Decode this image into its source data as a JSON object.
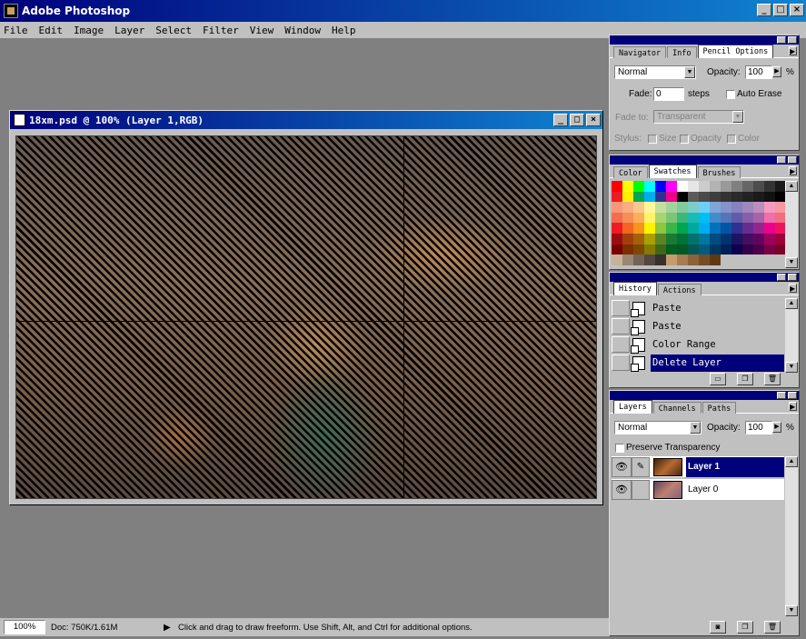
{
  "app": {
    "title": "Adobe Photoshop"
  },
  "window_buttons": {
    "minimize": "_",
    "maximize": "□",
    "close": "×"
  },
  "menu": [
    "File",
    "Edit",
    "Image",
    "Layer",
    "Select",
    "Filter",
    "View",
    "Window",
    "Help"
  ],
  "document": {
    "title": "18xm.psd @ 100% (Layer 1,RGB)"
  },
  "navigator_panel": {
    "tabs": [
      "Navigator",
      "Info",
      "Pencil Options"
    ],
    "active_tab": "Pencil Options",
    "mode": "Normal",
    "opacity_label": "Opacity:",
    "opacity_value": "100",
    "percent": "%",
    "fade_label": "Fade:",
    "fade_value": "0",
    "fade_unit": "steps",
    "auto_erase": "Auto Erase",
    "fade_to_label": "Fade to:",
    "fade_to_value": "Transparent",
    "stylus_label": "Stylus:",
    "stylus_size": "Size",
    "stylus_opacity": "Opacity",
    "stylus_color": "Color"
  },
  "color_panel": {
    "tabs": [
      "Color",
      "Swatches",
      "Brushes"
    ],
    "active_tab": "Swatches",
    "swatches": [
      "#ff0000",
      "#ffff00",
      "#00ff00",
      "#00ffff",
      "#0000ff",
      "#ff00ff",
      "#ffffff",
      "#e6e6e6",
      "#cccccc",
      "#b3b3b3",
      "#999999",
      "#808080",
      "#666666",
      "#4d4d4d",
      "#333333",
      "#1a1a1a",
      "#ed1c24",
      "#fff200",
      "#00a651",
      "#00aeef",
      "#2e3192",
      "#ec008c",
      "#000000",
      "#5a5a5a",
      "#4a4a4a",
      "#3e3e3e",
      "#333333",
      "#2a2a2a",
      "#222222",
      "#1a1a1a",
      "#111111",
      "#000000",
      "#f7977a",
      "#f9ad81",
      "#fdc68a",
      "#fff79a",
      "#c4df9b",
      "#a3d39c",
      "#82ca9d",
      "#7bcdc8",
      "#6ecff6",
      "#7ea7d8",
      "#8493ca",
      "#8882be",
      "#a187be",
      "#bc8dbf",
      "#f49ac2",
      "#f6989d",
      "#f26c4f",
      "#f68e55",
      "#fbaf5c",
      "#fff467",
      "#acd372",
      "#7cc576",
      "#3bb878",
      "#1abbb4",
      "#00bff3",
      "#438ccb",
      "#5574b9",
      "#605ca8",
      "#855fa8",
      "#a763a8",
      "#f06ea9",
      "#f26d7d",
      "#ed1c24",
      "#f26522",
      "#f7941d",
      "#fff200",
      "#8dc63f",
      "#39b54a",
      "#00a651",
      "#00a99d",
      "#00aeef",
      "#0072bc",
      "#0054a6",
      "#2e3192",
      "#662d91",
      "#92278f",
      "#ec008c",
      "#ed145b",
      "#9e0b0f",
      "#a0410d",
      "#a3620a",
      "#aba000",
      "#598527",
      "#1a7b30",
      "#007236",
      "#00746b",
      "#0076a3",
      "#004b80",
      "#003471",
      "#1b1464",
      "#440e62",
      "#630460",
      "#9e005d",
      "#9e0039",
      "#790000",
      "#7b2e00",
      "#7d4900",
      "#827b00",
      "#406618",
      "#005e20",
      "#005826",
      "#005952",
      "#005b7f",
      "#003663",
      "#002157",
      "#0d004c",
      "#32004b",
      "#4b0049",
      "#7b0046",
      "#7a0026",
      "#c7b299",
      "#998675",
      "#736357",
      "#534741",
      "#37302d",
      "#c69c6d",
      "#a67c52",
      "#8c6239",
      "#754c24",
      "#603913",
      "#c0c0c0",
      "#c0c0c0",
      "#c0c0c0",
      "#c0c0c0",
      "#c0c0c0",
      "#c0c0c0"
    ]
  },
  "history_panel": {
    "tabs": [
      "History",
      "Actions"
    ],
    "active_tab": "History",
    "items": [
      "Paste",
      "Paste",
      "Color Range",
      "Delete Layer"
    ],
    "selected_index": 3
  },
  "layers_panel": {
    "tabs": [
      "Layers",
      "Channels",
      "Paths"
    ],
    "active_tab": "Layers",
    "mode": "Normal",
    "opacity_label": "Opacity:",
    "opacity_value": "100",
    "percent": "%",
    "preserve_transparency": "Preserve Transparency",
    "layers": [
      "Layer 1",
      "Layer 0"
    ],
    "selected_layer": "Layer 1"
  },
  "status": {
    "zoom": "100%",
    "doc": "Doc: 750K/1.61M",
    "hint": "Click and drag to draw freeform.  Use Shift, Alt, and Ctrl for additional options."
  },
  "colors": {
    "titlebar": "#00007b",
    "selection": "#00007b",
    "chrome": "#c0c0c0",
    "workspace": "#808080"
  }
}
